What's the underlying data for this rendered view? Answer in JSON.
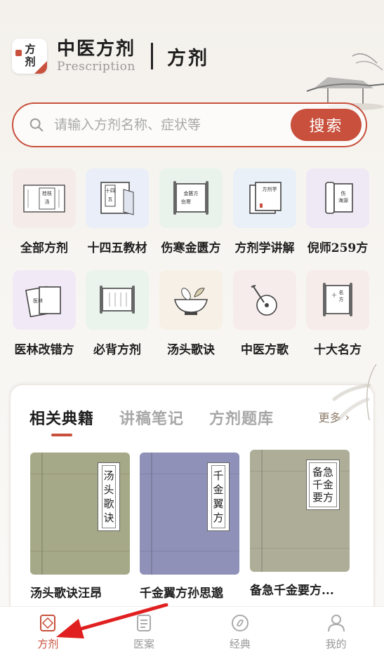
{
  "header": {
    "logo_text": "方剂",
    "title_cn": "中医方剂",
    "title_en": "Prescription",
    "page_title": "方剂"
  },
  "search": {
    "placeholder": "请输入方剂名称、症状等",
    "button_label": "搜索"
  },
  "categories": [
    {
      "label": "全部方剂",
      "icon": "scroll-prescriptions-icon",
      "bg": "#f5ebe8"
    },
    {
      "label": "十四五教材",
      "icon": "textbook-icon",
      "bg": "#e9eef8"
    },
    {
      "label": "伤寒金匮方",
      "icon": "classic-scroll-icon",
      "bg": "#e9f3ec"
    },
    {
      "label": "方剂学讲解",
      "icon": "lecture-book-icon",
      "bg": "#eaf0f8"
    },
    {
      "label": "倪师259方",
      "icon": "book-stack-icon",
      "bg": "#efe9f6"
    },
    {
      "label": "医林改错方",
      "icon": "corrected-book-icon",
      "bg": "#f2e9f6"
    },
    {
      "label": "必背方剂",
      "icon": "open-scroll-icon",
      "bg": "#eaf4ec"
    },
    {
      "label": "汤头歌诀",
      "icon": "mortar-herb-icon",
      "bg": "#f7f0e6"
    },
    {
      "label": "中医方歌",
      "icon": "pipa-icon",
      "bg": "#f6ecec"
    },
    {
      "label": "十大名方",
      "icon": "famous-scroll-icon",
      "bg": "#f6ecea"
    }
  ],
  "panel": {
    "tabs": [
      "相关典籍",
      "讲稿笔记",
      "方剂题库"
    ],
    "active_tab": 0,
    "more_label": "更多"
  },
  "books": [
    {
      "title": "汤头歌诀汪昂",
      "cover_label": "汤头歌诀",
      "cover_color": "#a6a987"
    },
    {
      "title": "千金翼方孙思邈",
      "cover_label": "千金翼方",
      "cover_color": "#8f91b8"
    },
    {
      "title": "备急千金要方...",
      "cover_label": "备急千金要方",
      "cover_color": "#aeae98"
    }
  ],
  "nav": [
    {
      "label": "方剂",
      "icon": "prescription-icon",
      "active": true
    },
    {
      "label": "医案",
      "icon": "document-list-icon",
      "active": false
    },
    {
      "label": "经典",
      "icon": "classic-circle-icon",
      "active": false
    },
    {
      "label": "我的",
      "icon": "user-icon",
      "active": false
    }
  ],
  "colors": {
    "accent": "#c8503c",
    "annotation_arrow": "#e02020"
  }
}
